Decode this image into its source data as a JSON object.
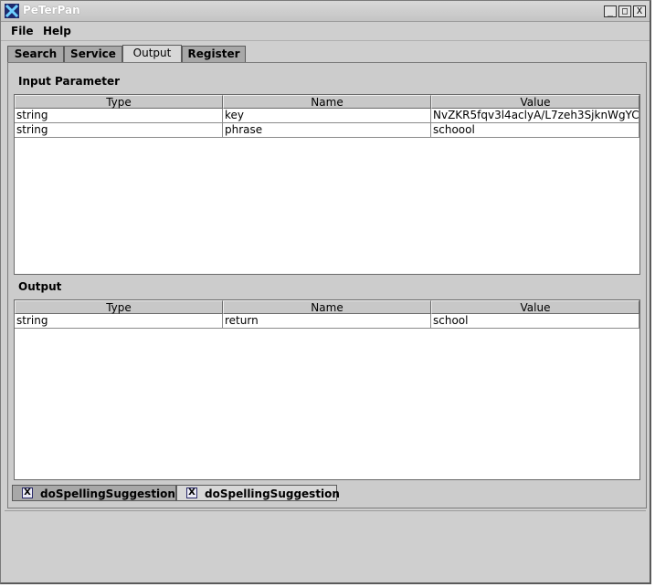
{
  "window": {
    "title": "PeTerPan"
  },
  "window_controls": {
    "minimize": "_",
    "maximize": "□",
    "close": "X"
  },
  "menu": {
    "file": "File",
    "help": "Help"
  },
  "tabs": [
    {
      "label": "Search"
    },
    {
      "label": "Service"
    },
    {
      "label": "Output",
      "active": true
    },
    {
      "label": "Register"
    }
  ],
  "input": {
    "title": "Input Parameter",
    "columns": [
      "Type",
      "Name",
      "Value"
    ],
    "rows": [
      [
        "string",
        "key",
        "NvZKR5fqv3l4aclyA/L7zeh3SjknWgYC"
      ],
      [
        "string",
        "phrase",
        "schoool"
      ]
    ]
  },
  "output": {
    "title": "Output",
    "columns": [
      "Type",
      "Name",
      "Value"
    ],
    "rows": [
      [
        "string",
        "return",
        "school"
      ]
    ]
  },
  "bottom_tabs": [
    {
      "label": "doSpellingSuggestion",
      "close": "X"
    },
    {
      "label": "doSpellingSuggestion",
      "close": "X"
    }
  ]
}
